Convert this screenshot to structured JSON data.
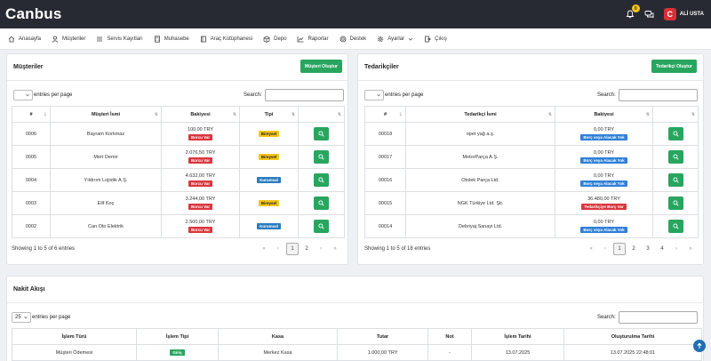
{
  "app": {
    "logo": "Canbus",
    "notification_count": "0",
    "user_initial": "C",
    "user_name": "ALİ USTA"
  },
  "nav": [
    {
      "label": "Anasayfa",
      "icon": "home-icon"
    },
    {
      "label": "Müşteriler",
      "icon": "user-icon"
    },
    {
      "label": "Servis Kayıtları",
      "icon": "list-icon"
    },
    {
      "label": "Muhasebe",
      "icon": "calculator-icon"
    },
    {
      "label": "Araç Kütüphanesi",
      "icon": "book-icon"
    },
    {
      "label": "Depo",
      "icon": "box-icon"
    },
    {
      "label": "Raporlar",
      "icon": "chart-icon"
    },
    {
      "label": "Destek",
      "icon": "support-icon"
    },
    {
      "label": "Ayarlar",
      "icon": "gear-icon"
    },
    {
      "label": "Çıkış",
      "icon": "logout-icon"
    }
  ],
  "customers": {
    "title": "Müşteriler",
    "create_label": "Müşteri Oluştur",
    "entries_label": "entries per page",
    "search_label": "Search:",
    "headers": [
      "#",
      "Müşteri İsmi",
      "Bakiyesi",
      "Tipi",
      ""
    ],
    "rows": [
      {
        "id": "0006",
        "name": "Bayram Korkmaz",
        "balance": "100,00 TRY",
        "badge": "Borcu Var",
        "type": "Bireysel",
        "type_color": "#f5c518"
      },
      {
        "id": "0005",
        "name": "Mert Demir",
        "balance": "2.076,50 TRY",
        "badge": "Borcu Var",
        "type": "Bireysel",
        "type_color": "#f5c518"
      },
      {
        "id": "0004",
        "name": "Yıldırım Lojistik A.Ş.",
        "balance": "4.632,00 TRY",
        "badge": "Borcu Var",
        "type": "Kurumsal",
        "type_color": "#2a7bbf"
      },
      {
        "id": "0003",
        "name": "Elif Koç",
        "balance": "3.244,00 TRY",
        "badge": "Borcu Var",
        "type": "Bireysel",
        "type_color": "#f5c518"
      },
      {
        "id": "0002",
        "name": "Can Oto Elektrik",
        "balance": "2.500,00 TRY",
        "badge": "Borcu Var",
        "type": "Kurumsal",
        "type_color": "#2a7bbf"
      }
    ],
    "footer": "Showing 1 to 5 of 6 entries",
    "pages": [
      "«",
      "‹",
      "1",
      "2",
      "›",
      "»"
    ],
    "active_page": "1"
  },
  "suppliers": {
    "title": "Tedarikçiler",
    "create_label": "Tedarikçi Oluştur",
    "entries_label": "entries per page",
    "search_label": "Search:",
    "headers": [
      "#",
      "Tedarikçi İsmi",
      "Bakiyesi",
      ""
    ],
    "rows": [
      {
        "id": "00018",
        "name": "opet yağ a.ş.",
        "balance": "0,00 TRY",
        "badge": "Borç veya Alacak Yok",
        "badge_color": "#2f7fd8"
      },
      {
        "id": "00017",
        "name": "MotorParça A.Ş.",
        "balance": "0,00 TRY",
        "badge": "Borç veya Alacak Yok",
        "badge_color": "#2f7fd8"
      },
      {
        "id": "00016",
        "name": "Otolek Parça Ltd.",
        "balance": "0,00 TRY",
        "badge": "Borç veya Alacak Yok",
        "badge_color": "#2f7fd8"
      },
      {
        "id": "00015",
        "name": "NGK Türkiye Ltd. Şti.",
        "balance": "36.480,00 TRY",
        "badge": "Tedarikçiye Borç Var",
        "badge_color": "#d9363e"
      },
      {
        "id": "00014",
        "name": "Debriyaj Sanayi Ltd.",
        "balance": "0,00 TRY",
        "badge": "Borç veya Alacak Yok",
        "badge_color": "#2f7fd8"
      }
    ],
    "footer": "Showing 1 to 5 of 18 entries",
    "pages": [
      "«",
      "‹",
      "1",
      "2",
      "3",
      "4",
      "›",
      "»"
    ],
    "active_page": "1"
  },
  "cashflow": {
    "title": "Nakit Akışı",
    "per_page": "25",
    "entries_label": "entries per page",
    "search_label": "Search:",
    "headers": [
      "İşlem Türü",
      "İşlem Tipi",
      "Kasa",
      "Tutar",
      "Not",
      "İşlem Tarihi",
      "Oluşturulma Tarihi"
    ],
    "rows": [
      {
        "type": "Müşteri Ödemesi",
        "kind": "Giriş",
        "kasa": "Merkez Kasa",
        "amount": "1.000,00 TRY",
        "note": "-",
        "date": "13.07.2025",
        "created": "13.07.2025 22:48:01"
      }
    ]
  },
  "colors": {
    "accent_green": "#28a55f",
    "debt_red": "#d9363e",
    "info_blue": "#2f7fd8",
    "topbar": "#272a33"
  }
}
